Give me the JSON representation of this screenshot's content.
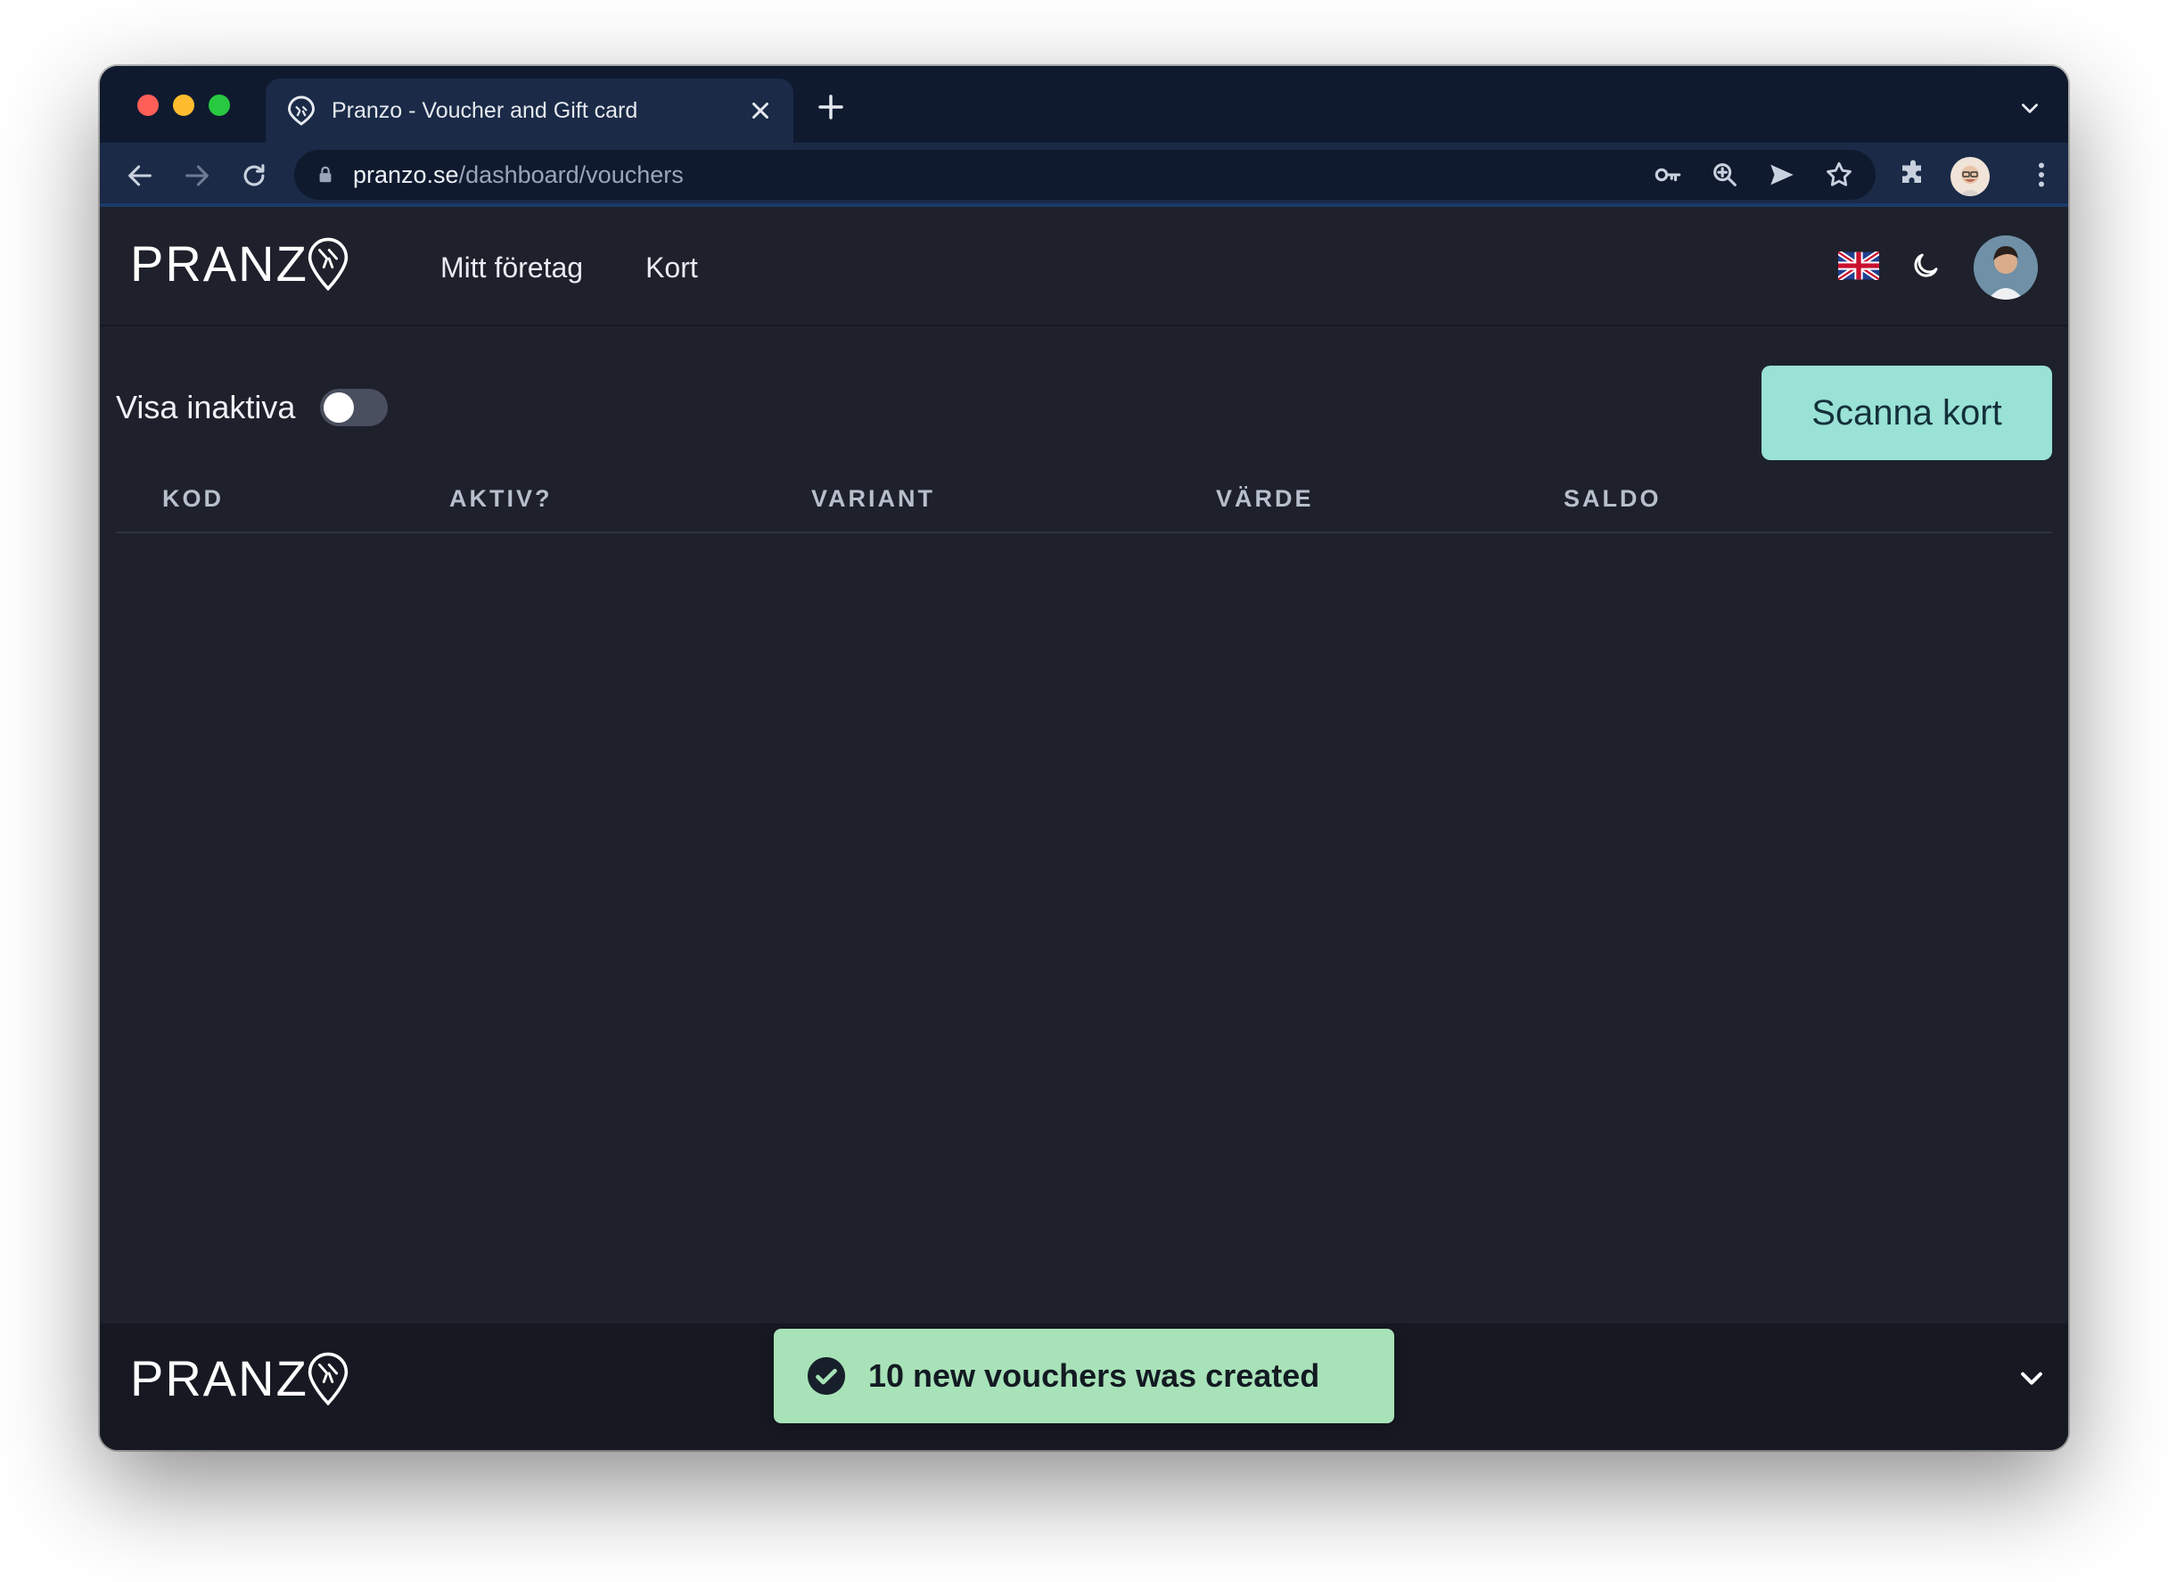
{
  "browser": {
    "tab_title": "Pranzo - Voucher and Gift card",
    "url_host": "pranzo.se",
    "url_path": "/dashboard/vouchers"
  },
  "header": {
    "logo_text": "PRANZ",
    "nav": [
      "Mitt företag",
      "Kort"
    ],
    "language_icon": "uk-flag-icon",
    "theme_icon": "moon-icon"
  },
  "filters": {
    "show_inactive_label": "Visa inaktiva",
    "show_inactive_on": false
  },
  "actions": {
    "scan_label": "Scanna kort"
  },
  "table": {
    "columns": [
      "KOD",
      "AKTIV?",
      "VARIANT",
      "VÄRDE",
      "SALDO"
    ],
    "rows": []
  },
  "footer": {
    "logo_text": "PRANZ"
  },
  "toast": {
    "message": "10 new vouchers was created",
    "type": "success"
  },
  "colors": {
    "accent": "#99e2d5",
    "toast_bg": "#a8e2b8",
    "background": "#1e212b"
  }
}
